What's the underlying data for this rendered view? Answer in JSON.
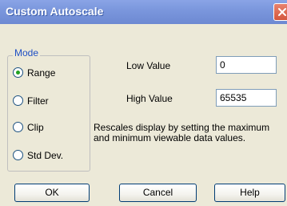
{
  "window": {
    "title": "Custom Autoscale"
  },
  "mode": {
    "legend": "Mode",
    "options": [
      {
        "label": "Range",
        "selected": true
      },
      {
        "label": "Filter",
        "selected": false
      },
      {
        "label": "Clip",
        "selected": false
      },
      {
        "label": "Std Dev.",
        "selected": false
      }
    ]
  },
  "fields": {
    "low": {
      "label": "Low Value",
      "value": "0"
    },
    "high": {
      "label": "High Value",
      "value": "65535"
    }
  },
  "description": "Rescales display by setting the maximum and minimum viewable data values.",
  "buttons": {
    "ok": "OK",
    "cancel": "Cancel",
    "help": "Help"
  },
  "icons": {
    "close": "close-icon"
  },
  "colors": {
    "titlebar": "#7b97dd",
    "radio_selected": "#21a121",
    "group_legend": "#1f4fc4"
  }
}
